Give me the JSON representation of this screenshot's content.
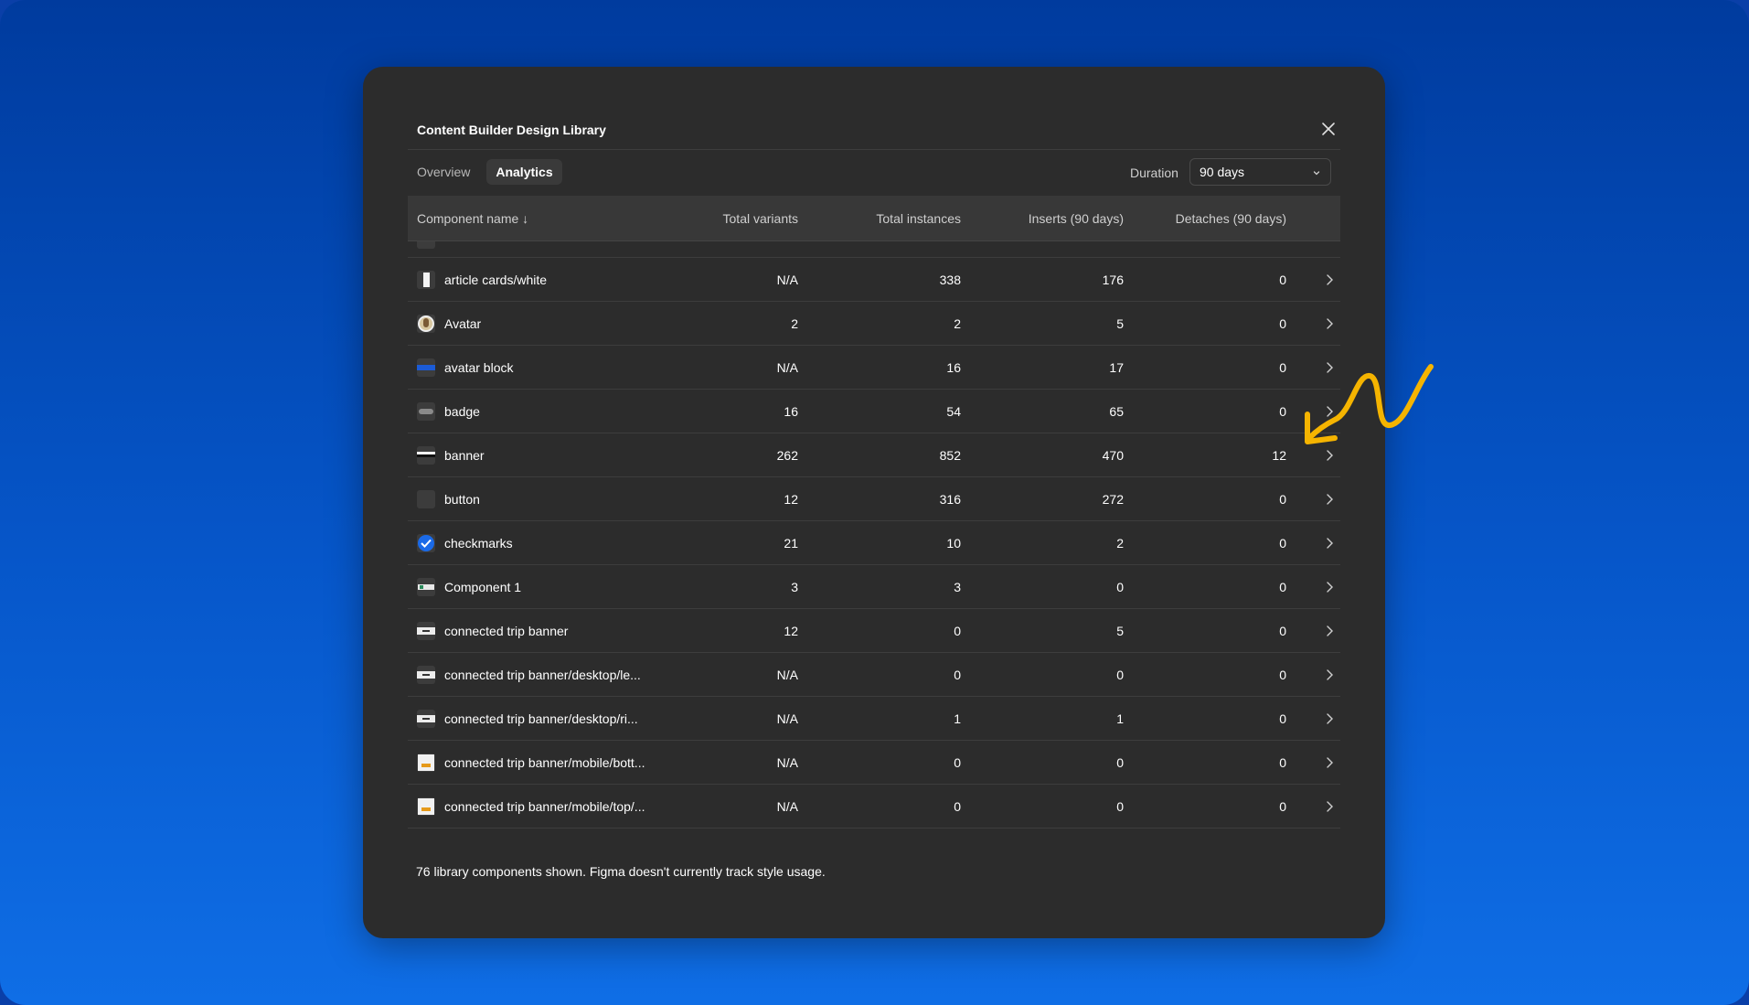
{
  "modal": {
    "title": "Content Builder Design Library",
    "tabs": [
      {
        "label": "Overview",
        "active": false
      },
      {
        "label": "Analytics",
        "active": true
      }
    ],
    "duration_label": "Duration",
    "duration_value": "90 days"
  },
  "table": {
    "columns": {
      "name": "Component name ↓",
      "variants": "Total variants",
      "instances": "Total instances",
      "inserts": "Inserts (90 days)",
      "detaches": "Detaches (90 days)"
    },
    "rows": [
      {
        "name": "article cards/white",
        "variants": "N/A",
        "instances": "338",
        "inserts": "176",
        "detaches": "0",
        "icon": "white-card-thumbnail"
      },
      {
        "name": "Avatar",
        "variants": "2",
        "instances": "2",
        "inserts": "5",
        "detaches": "0",
        "icon": "avatar-thumbnail"
      },
      {
        "name": "avatar block",
        "variants": "N/A",
        "instances": "16",
        "inserts": "17",
        "detaches": "0",
        "icon": "blue-block-thumbnail"
      },
      {
        "name": "badge",
        "variants": "16",
        "instances": "54",
        "inserts": "65",
        "detaches": "0",
        "icon": "badge-thumbnail"
      },
      {
        "name": "banner",
        "variants": "262",
        "instances": "852",
        "inserts": "470",
        "detaches": "12",
        "icon": "banner-thumbnail"
      },
      {
        "name": "button",
        "variants": "12",
        "instances": "316",
        "inserts": "272",
        "detaches": "0",
        "icon": "button-thumbnail"
      },
      {
        "name": "checkmarks",
        "variants": "21",
        "instances": "10",
        "inserts": "2",
        "detaches": "0",
        "icon": "checkmark-thumbnail"
      },
      {
        "name": "Component 1",
        "variants": "3",
        "instances": "3",
        "inserts": "0",
        "detaches": "0",
        "icon": "component-thumbnail"
      },
      {
        "name": "connected trip banner",
        "variants": "12",
        "instances": "0",
        "inserts": "5",
        "detaches": "0",
        "icon": "trip-banner-thumbnail"
      },
      {
        "name": "connected trip banner/desktop/le...",
        "variants": "N/A",
        "instances": "0",
        "inserts": "0",
        "detaches": "0",
        "icon": "trip-banner-thumbnail"
      },
      {
        "name": "connected trip banner/desktop/ri...",
        "variants": "N/A",
        "instances": "1",
        "inserts": "1",
        "detaches": "0",
        "icon": "trip-banner-thumbnail"
      },
      {
        "name": "connected trip banner/mobile/bott...",
        "variants": "N/A",
        "instances": "0",
        "inserts": "0",
        "detaches": "0",
        "icon": "mobile-banner-thumbnail"
      },
      {
        "name": "connected trip banner/mobile/top/...",
        "variants": "N/A",
        "instances": "0",
        "inserts": "0",
        "detaches": "0",
        "icon": "mobile-banner-thumbnail"
      }
    ]
  },
  "footer": "76 library components shown. Figma doesn't currently track style usage.",
  "colors": {
    "background_top": "#003b9e",
    "background_bottom": "#0f6ee6",
    "modal": "#2c2c2c",
    "annotation": "#f5b400"
  }
}
